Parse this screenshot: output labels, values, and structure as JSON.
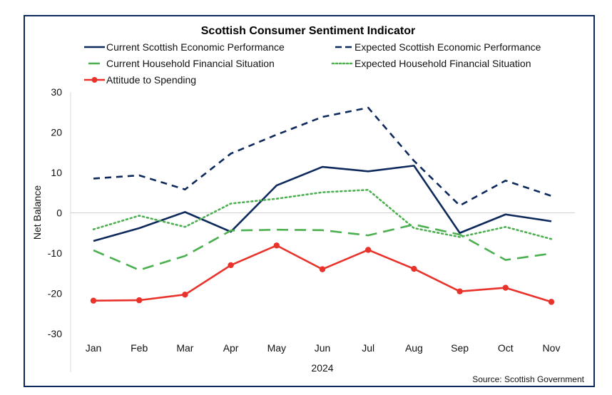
{
  "chart_data": {
    "type": "line",
    "title": "Scottish Consumer Sentiment Indicator",
    "xlabel": "2024",
    "ylabel": "Net Balance",
    "source": "Source: Scottish Government",
    "categories": [
      "Jan",
      "Feb",
      "Mar",
      "Apr",
      "May",
      "Jun",
      "Jul",
      "Aug",
      "Sep",
      "Oct",
      "Nov"
    ],
    "ylim": [
      -30,
      30
    ],
    "yticks": [
      30,
      20,
      10,
      0,
      -10,
      -20,
      -30
    ],
    "grid": false,
    "zero_line": true,
    "legend_position": "top",
    "series": [
      {
        "name": "Current Scottish Economic Performance",
        "color": "#0e2a5c",
        "style": "solid",
        "markers": false,
        "values": [
          -7.0,
          -3.8,
          0.2,
          -4.7,
          6.8,
          11.4,
          10.3,
          11.7,
          -5.0,
          -0.4,
          -2.1
        ]
      },
      {
        "name": "Expected Scottish Economic Performance",
        "color": "#0e2a5c",
        "style": "dashed",
        "markers": false,
        "values": [
          8.5,
          9.3,
          5.8,
          14.7,
          19.4,
          23.8,
          26.1,
          12.9,
          1.8,
          8.0,
          4.2
        ]
      },
      {
        "name": "Current Household Financial Situation",
        "color": "#4caf50",
        "style": "longdash",
        "markers": false,
        "values": [
          -9.3,
          -14.2,
          -10.7,
          -4.4,
          -4.2,
          -4.3,
          -5.6,
          -2.9,
          -5.4,
          -11.7,
          -10.1
        ]
      },
      {
        "name": "Expected Household Financial Situation",
        "color": "#4caf50",
        "style": "dotted",
        "markers": false,
        "values": [
          -4.1,
          -0.7,
          -3.5,
          2.3,
          3.5,
          5.1,
          5.7,
          -3.8,
          -6.0,
          -3.5,
          -6.5
        ]
      },
      {
        "name": "Attitude to Spending",
        "color": "#e8322a",
        "style": "solid",
        "markers": true,
        "values": [
          -21.8,
          -21.7,
          -20.3,
          -13.0,
          -8.1,
          -14.0,
          -9.2,
          -13.9,
          -19.5,
          -18.6,
          -22.1
        ]
      }
    ]
  }
}
